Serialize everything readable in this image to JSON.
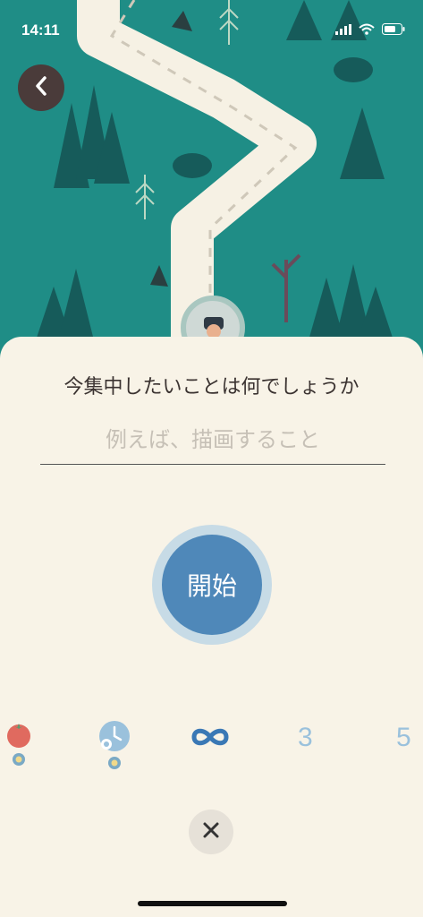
{
  "status": {
    "time": "14:11"
  },
  "header": {
    "back_icon": "chevron-left-icon"
  },
  "prompt": {
    "question": "今集中したいことは何でしょうか",
    "placeholder": "例えば、描画すること",
    "value": ""
  },
  "start_button": {
    "label": "開始"
  },
  "modes": [
    {
      "name": "pomodoro",
      "icon": "tomato-icon"
    },
    {
      "name": "custom-timer",
      "icon": "clock-gear-icon"
    },
    {
      "name": "infinity",
      "icon": "infinity-icon",
      "selected": true
    },
    {
      "name": "three",
      "label": "3"
    },
    {
      "name": "five",
      "label": "5"
    }
  ],
  "colors": {
    "map_bg": "#1f8d86",
    "sheet_bg": "#f8f3e7",
    "primary_blue": "#4f88b9"
  }
}
